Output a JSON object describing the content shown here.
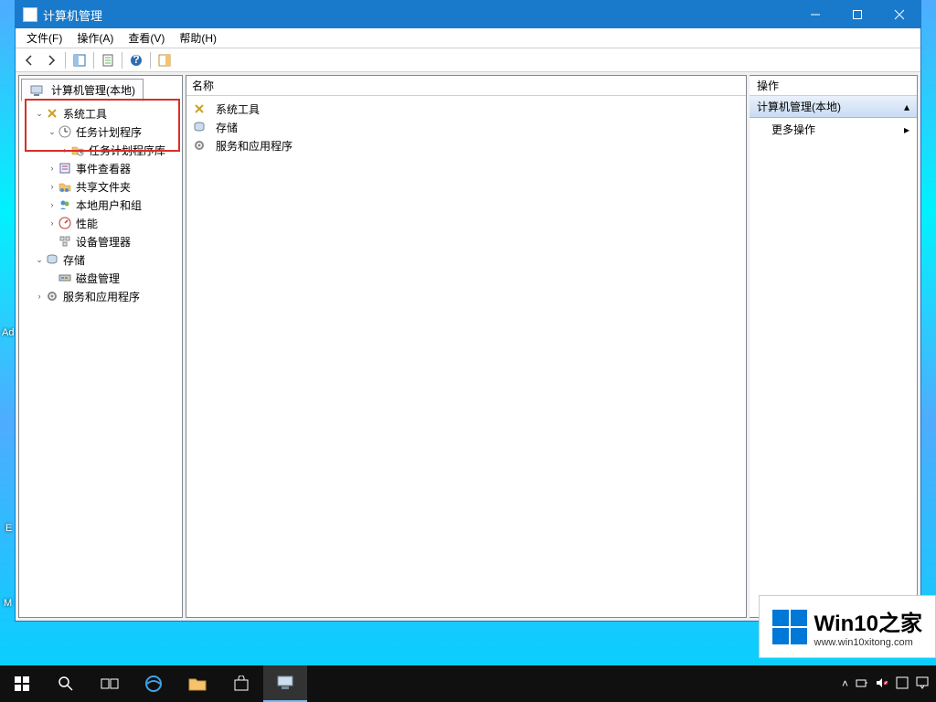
{
  "window": {
    "title": "计算机管理"
  },
  "menu": {
    "file": "文件(F)",
    "action": "操作(A)",
    "view": "查看(V)",
    "help": "帮助(H)"
  },
  "tree": {
    "root": "计算机管理(本地)",
    "system_tools": "系统工具",
    "task_scheduler": "任务计划程序",
    "task_scheduler_library": "任务计划程序库",
    "event_viewer": "事件查看器",
    "shared_folders": "共享文件夹",
    "local_users_groups": "本地用户和组",
    "performance": "性能",
    "device_manager": "设备管理器",
    "storage": "存储",
    "disk_management": "磁盘管理",
    "services_apps": "服务和应用程序"
  },
  "mid": {
    "header": "名称",
    "items": [
      "系统工具",
      "存储",
      "服务和应用程序"
    ]
  },
  "actions": {
    "header": "操作",
    "group": "计算机管理(本地)",
    "more": "更多操作"
  },
  "desktop": {
    "label1": "Ad",
    "label2": "E",
    "label3": "M"
  },
  "watermark": {
    "brand1": "Win10",
    "brand2": "之家",
    "url": "www.win10xitong.com"
  }
}
